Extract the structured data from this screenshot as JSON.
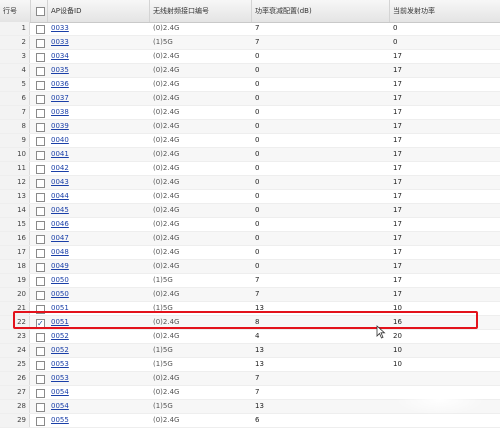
{
  "headers": {
    "row_no": "行号",
    "ap_id": "AP设备ID",
    "band": "无线射频接口编号",
    "atten": "功率衰减配置(dB)",
    "power": "当前发射功率"
  },
  "rows": [
    {
      "n": "1",
      "id": "0033",
      "band": "(0)2.4G",
      "atten": "7",
      "power": "0",
      "checked": false
    },
    {
      "n": "2",
      "id": "0033",
      "band": "(1)5G",
      "atten": "7",
      "power": "0",
      "checked": false
    },
    {
      "n": "3",
      "id": "0034",
      "band": "(0)2.4G",
      "atten": "0",
      "power": "17",
      "checked": false
    },
    {
      "n": "4",
      "id": "0035",
      "band": "(0)2.4G",
      "atten": "0",
      "power": "17",
      "checked": false
    },
    {
      "n": "5",
      "id": "0036",
      "band": "(0)2.4G",
      "atten": "0",
      "power": "17",
      "checked": false
    },
    {
      "n": "6",
      "id": "0037",
      "band": "(0)2.4G",
      "atten": "0",
      "power": "17",
      "checked": false
    },
    {
      "n": "7",
      "id": "0038",
      "band": "(0)2.4G",
      "atten": "0",
      "power": "17",
      "checked": false
    },
    {
      "n": "8",
      "id": "0039",
      "band": "(0)2.4G",
      "atten": "0",
      "power": "17",
      "checked": false
    },
    {
      "n": "9",
      "id": "0040",
      "band": "(0)2.4G",
      "atten": "0",
      "power": "17",
      "checked": false
    },
    {
      "n": "10",
      "id": "0041",
      "band": "(0)2.4G",
      "atten": "0",
      "power": "17",
      "checked": false
    },
    {
      "n": "11",
      "id": "0042",
      "band": "(0)2.4G",
      "atten": "0",
      "power": "17",
      "checked": false
    },
    {
      "n": "12",
      "id": "0043",
      "band": "(0)2.4G",
      "atten": "0",
      "power": "17",
      "checked": false
    },
    {
      "n": "13",
      "id": "0044",
      "band": "(0)2.4G",
      "atten": "0",
      "power": "17",
      "checked": false
    },
    {
      "n": "14",
      "id": "0045",
      "band": "(0)2.4G",
      "atten": "0",
      "power": "17",
      "checked": false
    },
    {
      "n": "15",
      "id": "0046",
      "band": "(0)2.4G",
      "atten": "0",
      "power": "17",
      "checked": false
    },
    {
      "n": "16",
      "id": "0047",
      "band": "(0)2.4G",
      "atten": "0",
      "power": "17",
      "checked": false
    },
    {
      "n": "17",
      "id": "0048",
      "band": "(0)2.4G",
      "atten": "0",
      "power": "17",
      "checked": false
    },
    {
      "n": "18",
      "id": "0049",
      "band": "(0)2.4G",
      "atten": "0",
      "power": "17",
      "checked": false
    },
    {
      "n": "19",
      "id": "0050",
      "band": "(1)5G",
      "atten": "7",
      "power": "17",
      "checked": false
    },
    {
      "n": "20",
      "id": "0050",
      "band": "(0)2.4G",
      "atten": "7",
      "power": "17",
      "checked": false
    },
    {
      "n": "21",
      "id": "0051",
      "band": "(1)5G",
      "atten": "13",
      "power": "10",
      "checked": false
    },
    {
      "n": "22",
      "id": "0051",
      "band": "(0)2.4G",
      "atten": "8",
      "power": "16",
      "checked": true
    },
    {
      "n": "23",
      "id": "0052",
      "band": "(0)2.4G",
      "atten": "4",
      "power": "20",
      "checked": false
    },
    {
      "n": "24",
      "id": "0052",
      "band": "(1)5G",
      "atten": "13",
      "power": "10",
      "checked": false
    },
    {
      "n": "25",
      "id": "0053",
      "band": "(1)5G",
      "atten": "13",
      "power": "10",
      "checked": false
    },
    {
      "n": "26",
      "id": "0053",
      "band": "(0)2.4G",
      "atten": "7",
      "power": "",
      "checked": false
    },
    {
      "n": "27",
      "id": "0054",
      "band": "(0)2.4G",
      "atten": "7",
      "power": "",
      "checked": false
    },
    {
      "n": "28",
      "id": "0054",
      "band": "(1)5G",
      "atten": "13",
      "power": "",
      "checked": false
    },
    {
      "n": "29",
      "id": "0055",
      "band": "(0)2.4G",
      "atten": "6",
      "power": "",
      "checked": false
    }
  ]
}
